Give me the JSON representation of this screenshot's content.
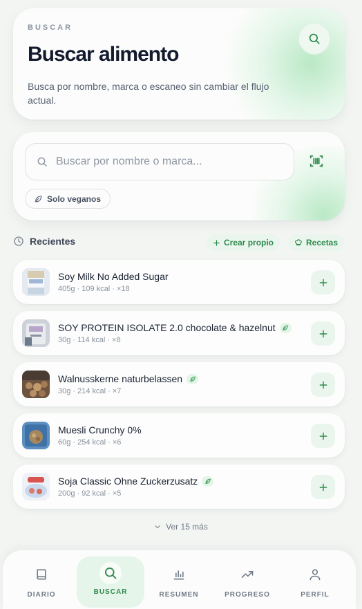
{
  "header": {
    "eyebrow": "BUSCAR",
    "title": "Buscar alimento",
    "subtitle": "Busca por nombre, marca o escaneo sin cambiar el flujo actual."
  },
  "search": {
    "placeholder": "Buscar por nombre o marca...",
    "value": "",
    "vegan_filter_label": "Solo veganos"
  },
  "recent": {
    "label": "Recientes",
    "create_label": "Crear propio",
    "recipes_label": "Recetas",
    "items": [
      {
        "name": "Soy Milk No Added Sugar",
        "meta": "405g · 109 kcal · ×18",
        "vegan": false
      },
      {
        "name": "SOY PROTEIN ISOLATE 2.0 chocolate & hazelnut",
        "meta": "30g · 114 kcal · ×8",
        "vegan": true
      },
      {
        "name": "Walnusskerne naturbelassen",
        "meta": "30g · 214 kcal · ×7",
        "vegan": true
      },
      {
        "name": "Muesli Crunchy 0%",
        "meta": "60g · 254 kcal · ×6",
        "vegan": false
      },
      {
        "name": "Soja Classic Ohne Zuckerzusatz",
        "meta": "200g · 92 kcal · ×5",
        "vegan": true
      }
    ],
    "more_label": "Ver 15 más"
  },
  "nav": {
    "items": [
      {
        "label": "DIARIO",
        "icon": "book-icon",
        "active": false
      },
      {
        "label": "BUSCAR",
        "icon": "search-icon",
        "active": true
      },
      {
        "label": "RESUMEN",
        "icon": "bar-chart-icon",
        "active": false
      },
      {
        "label": "PROGRESO",
        "icon": "trend-up-icon",
        "active": false
      },
      {
        "label": "PERFIL",
        "icon": "user-icon",
        "active": false
      }
    ]
  },
  "colors": {
    "accent": "#2f8a4e",
    "accent_soft": "#eaf6ed",
    "background": "#f3f5f3",
    "title": "#141b2e"
  }
}
